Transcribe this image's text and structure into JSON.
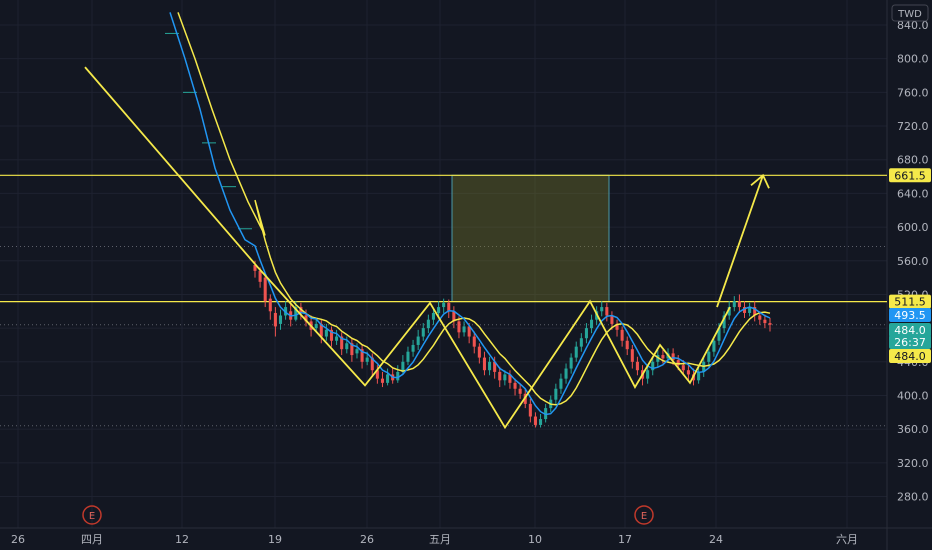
{
  "chart_data": {
    "type": "candlestick",
    "currency": "TWD",
    "y_ticks": [
      280,
      320,
      360,
      400,
      440,
      480,
      520,
      560,
      600,
      640,
      680,
      720,
      760,
      800,
      840
    ],
    "y_tick_labels": [
      "280.0",
      "320.0",
      "360.0",
      "400.0",
      "440.0",
      "480.0",
      "520.0",
      "560.0",
      "600.0",
      "640.0",
      "680.0",
      "720.0",
      "760.0",
      "800.0",
      "840.0"
    ],
    "x_ticks": [
      {
        "date": "Mar 26",
        "label": "26"
      },
      {
        "date": "Apr 1",
        "label": "四月"
      },
      {
        "date": "Apr 12",
        "label": "12"
      },
      {
        "date": "Apr 19",
        "label": "19"
      },
      {
        "date": "Apr 26",
        "label": "26"
      },
      {
        "date": "May 1",
        "label": "五月"
      },
      {
        "date": "May 10",
        "label": "10"
      },
      {
        "date": "May 17",
        "label": "17"
      },
      {
        "date": "May 24",
        "label": "24"
      },
      {
        "date": "Jun 1",
        "label": "六月"
      }
    ],
    "horizontal_levels": [
      661.5,
      511.5
    ],
    "price_tags": [
      {
        "label": "661.5",
        "value": 661.5,
        "kind": "level"
      },
      {
        "label": "511.5",
        "value": 511.5,
        "kind": "level"
      },
      {
        "label": "493.5",
        "value": 493.5,
        "kind": "ma-blue"
      },
      {
        "label": "484.0",
        "value": 484.0,
        "kind": "last-price"
      },
      {
        "label": "26:37",
        "value": 484.0,
        "kind": "countdown"
      },
      {
        "label": "484.0",
        "value": 484.0,
        "kind": "ma-yellow"
      }
    ],
    "target_box": {
      "price_low": 511.5,
      "price_high": 661.5
    },
    "earnings_markers": [
      {
        "label": "E"
      },
      {
        "label": "E"
      }
    ],
    "candles": [
      [
        555,
        548,
        560,
        540
      ],
      [
        548,
        535,
        552,
        528
      ],
      [
        540,
        512,
        545,
        505
      ],
      [
        515,
        500,
        520,
        490
      ],
      [
        498,
        482,
        505,
        470
      ],
      [
        485,
        495,
        502,
        478
      ],
      [
        495,
        505,
        512,
        490
      ],
      [
        500,
        490,
        508,
        482
      ],
      [
        490,
        505,
        512,
        488
      ],
      [
        505,
        498,
        510,
        490
      ],
      [
        495,
        488,
        502,
        482
      ],
      [
        488,
        478,
        495,
        470
      ],
      [
        480,
        485,
        492,
        475
      ],
      [
        485,
        470,
        490,
        462
      ],
      [
        470,
        478,
        485,
        465
      ],
      [
        478,
        465,
        482,
        458
      ],
      [
        465,
        470,
        478,
        460
      ],
      [
        470,
        455,
        475,
        448
      ],
      [
        455,
        462,
        470,
        450
      ],
      [
        462,
        448,
        468,
        440
      ],
      [
        450,
        455,
        462,
        444
      ],
      [
        455,
        440,
        460,
        432
      ],
      [
        440,
        445,
        452,
        436
      ],
      [
        445,
        430,
        450,
        422
      ],
      [
        430,
        420,
        436,
        414
      ],
      [
        420,
        415,
        428,
        410
      ],
      [
        415,
        425,
        432,
        412
      ],
      [
        425,
        418,
        432,
        414
      ],
      [
        418,
        428,
        436,
        415
      ],
      [
        428,
        440,
        448,
        425
      ],
      [
        440,
        452,
        458,
        436
      ],
      [
        452,
        460,
        466,
        446
      ],
      [
        460,
        470,
        478,
        454
      ],
      [
        470,
        480,
        486,
        465
      ],
      [
        480,
        490,
        496,
        474
      ],
      [
        490,
        498,
        504,
        484
      ],
      [
        498,
        505,
        512,
        492
      ],
      [
        505,
        510,
        515,
        498
      ],
      [
        510,
        500,
        514,
        492
      ],
      [
        500,
        488,
        506,
        480
      ],
      [
        488,
        475,
        494,
        468
      ],
      [
        475,
        482,
        488,
        470
      ],
      [
        482,
        470,
        486,
        462
      ],
      [
        470,
        458,
        476,
        450
      ],
      [
        458,
        445,
        462,
        438
      ],
      [
        445,
        430,
        452,
        424
      ],
      [
        430,
        440,
        446,
        424
      ],
      [
        440,
        428,
        446,
        420
      ],
      [
        428,
        418,
        434,
        410
      ],
      [
        418,
        425,
        430,
        412
      ],
      [
        425,
        415,
        430,
        408
      ],
      [
        415,
        408,
        420,
        400
      ],
      [
        408,
        402,
        414,
        396
      ],
      [
        402,
        390,
        408,
        385
      ],
      [
        390,
        375,
        396,
        368
      ],
      [
        375,
        365,
        380,
        362
      ],
      [
        365,
        372,
        378,
        362
      ],
      [
        372,
        385,
        390,
        368
      ],
      [
        385,
        395,
        400,
        380
      ],
      [
        395,
        408,
        414,
        390
      ],
      [
        408,
        420,
        426,
        402
      ],
      [
        420,
        432,
        438,
        414
      ],
      [
        432,
        445,
        450,
        426
      ],
      [
        445,
        458,
        464,
        440
      ],
      [
        458,
        468,
        474,
        452
      ],
      [
        468,
        480,
        486,
        462
      ],
      [
        480,
        490,
        496,
        474
      ],
      [
        490,
        500,
        506,
        484
      ],
      [
        500,
        505,
        512,
        494
      ],
      [
        505,
        495,
        510,
        488
      ],
      [
        495,
        485,
        500,
        478
      ],
      [
        485,
        478,
        490,
        470
      ],
      [
        478,
        465,
        482,
        458
      ],
      [
        465,
        455,
        470,
        448
      ],
      [
        455,
        440,
        460,
        432
      ],
      [
        440,
        430,
        446,
        424
      ],
      [
        430,
        420,
        436,
        412
      ],
      [
        420,
        430,
        436,
        414
      ],
      [
        430,
        440,
        446,
        424
      ],
      [
        440,
        448,
        454,
        434
      ],
      [
        448,
        444,
        454,
        438
      ],
      [
        444,
        450,
        456,
        440
      ],
      [
        450,
        442,
        456,
        436
      ],
      [
        442,
        436,
        448,
        430
      ],
      [
        436,
        430,
        442,
        424
      ],
      [
        430,
        425,
        436,
        418
      ],
      [
        425,
        418,
        432,
        412
      ],
      [
        418,
        428,
        434,
        414
      ],
      [
        428,
        440,
        446,
        422
      ],
      [
        440,
        452,
        458,
        434
      ],
      [
        452,
        465,
        470,
        446
      ],
      [
        465,
        480,
        486,
        460
      ],
      [
        480,
        495,
        500,
        474
      ],
      [
        495,
        505,
        512,
        490
      ],
      [
        505,
        512,
        518,
        500
      ],
      [
        512,
        505,
        520,
        498
      ],
      [
        505,
        498,
        512,
        492
      ],
      [
        498,
        505,
        510,
        494
      ],
      [
        505,
        495,
        512,
        488
      ],
      [
        495,
        490,
        500,
        484
      ],
      [
        490,
        486,
        496,
        480
      ],
      [
        486,
        484,
        492,
        476
      ]
    ]
  }
}
